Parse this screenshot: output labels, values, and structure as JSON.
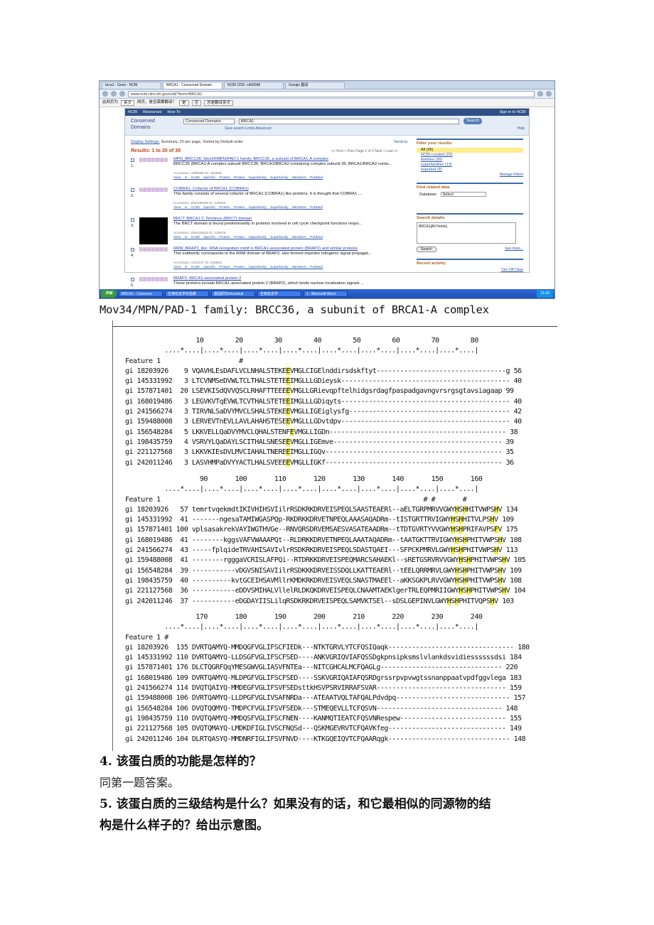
{
  "browser": {
    "tabs": [
      "brca1 - Gene - NCBI",
      "BRCA1 - Conserved Domain",
      "NCBI CDD: cd00068",
      "Google 翻译"
    ],
    "url": "www.ncbi.nlm.nih.gov/cdd/?term=BRCA1",
    "translate_bar": {
      "prefix": "此网页为",
      "language": "英文",
      "question": "网页，是否需要翻译？",
      "yes": "是",
      "no": "否",
      "never": "总是翻译英文"
    }
  },
  "ncbi": {
    "logo": "NCBI",
    "resources": "Resources",
    "howto": "How To",
    "signin": "Sign in to NCBI",
    "section_label": "Conserved Domains",
    "db_select": "Conserved Domains",
    "query": "BRCA1",
    "search_btn": "Search",
    "sublinks": "Save search   Limits   Advanced",
    "help": "Help",
    "display": "Display Settings:",
    "display_rest": "Summary, 20 per page, Sorted by Default order",
    "send_to": "Send to:",
    "results": "Results: 1 to 20 of 39",
    "pager": "<< First  < Prev  Page 1 of 2  Next >  Last >>",
    "items": [
      {
        "num": "1.",
        "title": "MPN_BRCC36: Mov34/MPN/PAD-1 family; BRCC36, a subunit of BRCA1-A complex",
        "desc": "BRCC36 (BRCA1-A complex subunit BRCC36; BRCA1/BRCA2-containing complex subunit 36; BRCA1/BRCA2-conta...",
        "acc": "Accession: cd08068   ID: 163699",
        "links": "View in Cn3D  Specific Protein  Protein  Superfamily  Superfamily Members  PubMed"
      },
      {
        "num": "2.",
        "title": "COBRA1: Cofactor of BRCA1 (COBRA1)",
        "desc": "This family consists of several cofactor of BRCA1 (COBRA1) like proteins. It is thought that COBRA1 ...",
        "acc": "Accession: pfam06209   ID: 218940",
        "links": "View in Cn3D  Specific Protein  Protein  Superfamily  Superfamily Members  PubMed"
      },
      {
        "num": "3.",
        "title": "BRCT: BRCA1 C Terminus (BRCT) domain",
        "desc": "The BRCT domain is found predominantly in proteins involved in cell cycle checkpoint functions respo...",
        "acc": "Accession: pfam00533   ID: 215978",
        "links": "View in Cn3D  Specific Protein  Protein  Superfamily  Superfamily Members  PubMed"
      },
      {
        "num": "4.",
        "title": "RRM_BRAP2_like: RNA recognition motif in BRCA1-associated protein (BRAP2) and similar proteins",
        "desc": "This subfamily corresponds to the RRM domain of BRAP2, also termed impedes mitogenic signal propagat...",
        "acc": "Accession: cd12437   ID: 240883",
        "links": "View in Cn3D  Specific Protein  Protein  Superfamily  Superfamily Members  PubMed"
      },
      {
        "num": "5.",
        "title": "BRAP2: BRCA1-associated protein 2",
        "desc": "These proteins include BRCA1-associated protein 2 (BRAP2), which binds nuclear localisation signals ...",
        "acc": "",
        "links": ""
      }
    ],
    "filter_head": "Filter your results:",
    "filters": [
      "All (39)",
      "NCBI-curated (22)",
      "families (30)",
      "superfamilies (13)",
      "imported (8)"
    ],
    "manage": "Manage Filters",
    "related_head": "Find related data",
    "database_label": "Database:",
    "database_value": "Select",
    "search_details_head": "Search details",
    "search_details": "BRCA1[All Fields]",
    "search_small": "Search",
    "see_more": "See more...",
    "recent_head": "Recent activity",
    "recent_links": "Turn Off  Clear"
  },
  "taskbar": {
    "start": "开始",
    "tasks": [
      "BRCA1 - Conserve",
      "生物信息学实验教",
      "基因研究zhouchuk",
      "生物信息学",
      "1 - Microsoft Word"
    ],
    "clock": "21:00"
  },
  "alignment": {
    "caption": "Mov34/MPN/PAD-1 family: BRCC36, a subunit of BRCA1-A complex",
    "blocks": [
      {
        "ruler": "                  10        20        30        40        50        60        70        80",
        "dots": "          ....*....|....*....|....*....|....*....|....*....|....*....|....*....|....*....|",
        "feature_label": "Feature 1",
        "feature_marks": "                             #",
        "rows": [
          {
            "id": "gi 18203926 ",
            "start": "  9",
            "pre": "VQAVHLEsDAFLVCLNHALSTEKE",
            "hl": "E",
            "post": "VMGLCIGElnddirsdskftyt---------------------------------g",
            "end": " 56"
          },
          {
            "id": "gi 145331992",
            "start": "  3",
            "pre": "LTCVNMSeDVWLTCLTHALSTETE",
            "hl": "E",
            "post": "IMGLLLGDieysk-------------------------------------------",
            "end": " 40"
          },
          {
            "id": "gi 157871401",
            "start": " 20",
            "pre": "LSEVKISdQVVQSCLRHAFTTEEE",
            "hl": "E",
            "post": "VMGLLGRievqpftelhidgsrdagfpaspadgavngvrsrgsgtavsiagaap",
            "end": " 99"
          },
          {
            "id": "gi 168019486",
            "start": "  3",
            "pre": "LEGVKVTqEVWLTCVTHALSTETE",
            "hl": "E",
            "post": "IMGLLLGDiqyts-------------------------------------------",
            "end": " 40"
          },
          {
            "id": "gi 241566274",
            "start": "  3",
            "pre": "TIRVNLSaDVYMVCLSHALSTEKE",
            "hl": "E",
            "post": "VMGLLIGEiglysfg-----------------------------------------",
            "end": " 42"
          },
          {
            "id": "gi 159488008",
            "start": "  3",
            "pre": "LERVEVTnEVLLAVLAHAHSTESE",
            "hl": "E",
            "post": "VMGLLLGDvtdpv-------------------------------------------",
            "end": " 40"
          },
          {
            "id": "gi 156548284",
            "start": "  5",
            "pre": "LKKVELLQaDVYMVCLQHALSTENF",
            "hl": "E",
            "post": "VMGLLIGDn---------------------------------------------",
            "end": " 38"
          },
          {
            "id": "gi 198435759",
            "start": "  4",
            "pre": "VSRVYLQaDAYLSCITHALSNESE",
            "hl": "E",
            "post": "VMGLLIGEmve-------------------------------------------",
            "end": " 39"
          },
          {
            "id": "gi 221127568",
            "start": "  3",
            "pre": "LKKVKIEsDVLMVCIAHALTNERE",
            "hl": "E",
            "post": "IMGLLIGQv---------------------------------------------",
            "end": " 35"
          },
          {
            "id": "gi 242011246",
            "start": "  3",
            "pre": "LASVHMPaDVYYACTLHALSVEEE",
            "hl": "E",
            "post": "VMGLLIGKf---------------------------------------------",
            "end": " 36"
          }
        ]
      },
      {
        "ruler": "                   90       100       110       120       130       140       150       160",
        "dots": "          ....*....|....*....|....*....|....*....|....*....|....*....|....*....|....*....|",
        "feature_label": "Feature 1",
        "feature_marks": "                                                                            # #       #",
        "rows": [
          {
            "id": "gi 18203926 ",
            "start": " 57",
            "pre": "temrtvqekmdtIKIVHIHSVIilrRSDKRKDRVEISPEQLSAASTEAERl--aELTGRPMRVVGWY",
            "hl": "H",
            "post": "S",
            "hl2": "H",
            "post2": "HITVWPS",
            "hl3": "H",
            "post3": "V",
            "end": " 134"
          },
          {
            "id": "gi 145331992",
            "start": " 41",
            "pre": "-------ngesaTAMIWGASPQp-RKDRKKDRVETNPEQLAAASAQADRm--tISTGRTTRVIGWY",
            "hl": "H",
            "post": "S",
            "hl2": "H",
            "post2": "HITVLPS",
            "hl3": "H",
            "post3": "V",
            "end": " 109"
          },
          {
            "id": "gi 157871401",
            "start": "100",
            "pre": "vplsasakrekVAYIWGTHVGe--RNVQRSDRVEMSAESVASATEAADRm--tTDTGVRTYVVGWY",
            "hl": "H",
            "post": "S",
            "hl2": "H",
            "post2": "PRIFAVPS",
            "hl3": "F",
            "post3": "V",
            "end": " 175"
          },
          {
            "id": "gi 168019486",
            "start": " 41",
            "pre": "--------kggsVAFVWAAAPQt--RLDRKKDRVETNPEQLAAATAQADRm--tAATGKTTRVIGWY",
            "hl": "H",
            "post": "S",
            "hl2": "H",
            "post2": "PHITVWPS",
            "hl3": "H",
            "post3": "V",
            "end": " 108"
          },
          {
            "id": "gi 241566274",
            "start": " 43",
            "pre": "-----fplqideTRVAHISAVIvlrRSDKRKDRVEISPEQLSDASTQAEI---SFPCKPMRVLGWY",
            "hl": "H",
            "post": "S",
            "hl2": "H",
            "post2": "PHITVWPS",
            "hl3": "H",
            "post3": "V",
            "end": " 113"
          },
          {
            "id": "gi 159488008",
            "start": " 41",
            "pre": "--------rgggaVCRISLAFPQi--RTDRKKDRVEISPEQMARCSAHAEKl--sRETGSRVRVVGWY",
            "hl": "H",
            "post": "S",
            "hl2": "H",
            "post2": "PHITVWPS",
            "hl3": "H",
            "post3": "V",
            "end": " 105"
          },
          {
            "id": "gi 156548284",
            "start": " 39",
            "pre": "-----------vDGVSNISAVIilrRSDKKKDRVEISSDQLLKATTEAERl--tEELQRRMRVLGWY",
            "hl": "H",
            "post": "S",
            "hl2": "H",
            "post2": "PHITVWPS",
            "hl3": "H",
            "post3": "V",
            "end": " 109"
          },
          {
            "id": "gi 198435759",
            "start": " 40",
            "pre": "----------kvtGCEIHSAVMllrKMDKRKDRVEISVEQLSNASTMAEEl--aKKSGKPLRVVGWY",
            "hl": "H",
            "post": "S",
            "hl2": "H",
            "post2": "PHITVWPS",
            "hl3": "H",
            "post3": "V",
            "end": " 108"
          },
          {
            "id": "gi 221127568",
            "start": " 36",
            "pre": "-----------eDDVSMIHALVllelRLDKQKDRVEISPEQLCNAAMTAEKlgerTRLEQPMRIIGWY",
            "hl": "H",
            "post": "S",
            "hl2": "H",
            "post2": "PHITVWPS",
            "hl3": "H",
            "post3": "V",
            "end": " 104"
          },
          {
            "id": "gi 242011246",
            "start": " 37",
            "pre": "-----------eDGDAYIISLilqRSDKRKDRVEISPEQLSAMVKTSEl--sDSLGEPINVLGWY",
            "hl": "H",
            "post": "S",
            "hl2": "H",
            "post2": "PHITVQPS",
            "hl3": "H",
            "post3": "V",
            "end": " 103"
          }
        ]
      },
      {
        "ruler": "                  170       180       190       200       210       220       230       240",
        "dots": "          ....*....|....*....|....*....|....*....|....*....|....*....|....*....|....*....|",
        "feature_label": "Feature 1",
        "feature_marks": "          #",
        "rows": [
          {
            "id": "gi 18203926 ",
            "start": "135",
            "seq": "DVRTQAMYQ-MMDQGFVGLIFSCFIEDk---NTKTGRVLYTCFQSIQaqk--------------------------------",
            "end": " 180"
          },
          {
            "id": "gi 145331992",
            "start": "110",
            "seq": "DVRTQAMYQ-LLDSGFVGLIFSCFSED----ANKVGRIQVIAFQSSDgkpnsipksmslvlankdsvidiessssssdsi",
            "end": " 184"
          },
          {
            "id": "gi 157871401",
            "start": "176",
            "seq": "DLCTQGRFQqYMESGWVGLIASVFNTEa---NITCGHCALMCFQAGLg-------------------------------",
            "end": " 220"
          },
          {
            "id": "gi 168019486",
            "start": "109",
            "seq": "DVRTQAMYQ-MLDPGFVGLIFSCFSED----SSKVGRIQAIAFQSRDgrssrpvpvwgtssnanppaatvpdfggvlega",
            "end": " 183"
          },
          {
            "id": "gi 241566274",
            "start": "114",
            "seq": "DVQTQAIYQ-MMDEGFVGLIFSVFSEDsttkHSVPSRVIRRAFSVAR---------------------------------",
            "end": " 159"
          },
          {
            "id": "gi 159488008",
            "start": "106",
            "seq": "DVRTQAMYQ-LLDPGFVGLIVSAFNRDa---ATEAATVQLTAFQALPdvdpq-----------------------------",
            "end": " 157"
          },
          {
            "id": "gi 156548284",
            "start": "106",
            "seq": "DVQTQQMYQ-TMDPCFVGLIFSVFSEDk---STMEQEVLLTCFQSVN--------------------------------",
            "end": " 148"
          },
          {
            "id": "gi 198435759",
            "start": "110",
            "seq": "DVQTQAMYQ-MMDQSFVGLIFSCFNEN----KANMQTIEATCFQSVNRespew---------------------------",
            "end": " 155"
          },
          {
            "id": "gi 221127568",
            "start": "105",
            "seq": "DVQTQMAYQ-LMDKDFIGLIVSCFNQSd---QSKMGEVRVTCFQAVKfeg------------------------------",
            "end": " 149"
          },
          {
            "id": "gi 242011246",
            "start": "104",
            "seq": "DLRTQASYQ-MMDNRFIGLIFSVFNVD----KTKGQEIQVTCFQAARqgk-------------------------------",
            "end": " 148"
          }
        ]
      }
    ]
  },
  "questions": {
    "q4": "4. 该蛋白质的功能是怎样的？",
    "a4": "同第一题答案。",
    "q5_line1": "5. 该蛋白质的三级结构是什么？如果没有的话，和它最相似的同源物的结",
    "q5_line2": "构是什么样子的？给出示意图。"
  }
}
